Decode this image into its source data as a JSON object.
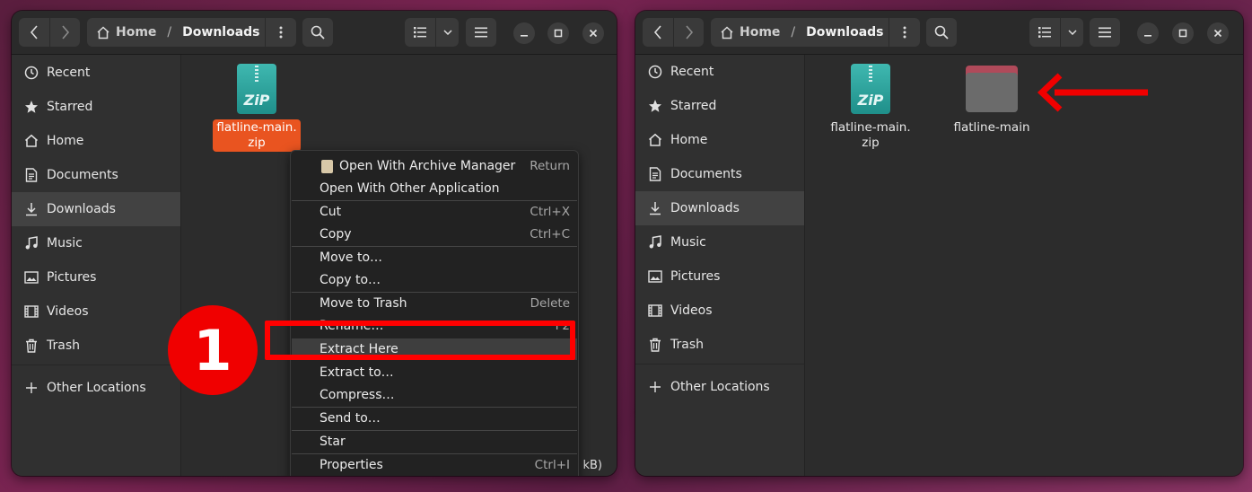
{
  "left_window": {
    "path": {
      "home": "Home",
      "current": "Downloads"
    },
    "sidebar": [
      {
        "label": "Recent",
        "icon": "clock-icon"
      },
      {
        "label": "Starred",
        "icon": "star-icon"
      },
      {
        "label": "Home",
        "icon": "home-icon"
      },
      {
        "label": "Documents",
        "icon": "document-icon"
      },
      {
        "label": "Downloads",
        "icon": "download-icon",
        "selected": true
      },
      {
        "label": "Music",
        "icon": "music-icon"
      },
      {
        "label": "Pictures",
        "icon": "picture-icon"
      },
      {
        "label": "Videos",
        "icon": "video-icon"
      },
      {
        "label": "Trash",
        "icon": "trash-icon"
      },
      {
        "label": "Other Locations",
        "icon": "plus-icon"
      }
    ],
    "files": [
      {
        "name_line1": "flatline-main.",
        "name_line2": "zip",
        "type": "zip",
        "selected": true
      }
    ],
    "status_fragment": "3 kB)",
    "context_menu": [
      {
        "label": "Open With Archive Manager",
        "accel": "Return",
        "icon": "archive-manager-icon"
      },
      {
        "label": "Open With Other Application",
        "accel": ""
      },
      {
        "label": "Cut",
        "accel": "Ctrl+X"
      },
      {
        "label": "Copy",
        "accel": "Ctrl+C"
      },
      {
        "label": "Move to…",
        "accel": ""
      },
      {
        "label": "Copy to…",
        "accel": ""
      },
      {
        "label": "Move to Trash",
        "accel": "Delete"
      },
      {
        "label": "Rename…",
        "accel": "F2"
      },
      {
        "label": "Extract Here",
        "accel": "",
        "hover": true
      },
      {
        "label": "Extract to…",
        "accel": ""
      },
      {
        "label": "Compress…",
        "accel": ""
      },
      {
        "label": "Send to…",
        "accel": ""
      },
      {
        "label": "Star",
        "accel": ""
      },
      {
        "label": "Properties",
        "accel": "Ctrl+I"
      }
    ]
  },
  "right_window": {
    "path": {
      "home": "Home",
      "current": "Downloads"
    },
    "sidebar": [
      {
        "label": "Recent",
        "icon": "clock-icon"
      },
      {
        "label": "Starred",
        "icon": "star-icon"
      },
      {
        "label": "Home",
        "icon": "home-icon"
      },
      {
        "label": "Documents",
        "icon": "document-icon"
      },
      {
        "label": "Downloads",
        "icon": "download-icon",
        "selected": true
      },
      {
        "label": "Music",
        "icon": "music-icon"
      },
      {
        "label": "Pictures",
        "icon": "picture-icon"
      },
      {
        "label": "Videos",
        "icon": "video-icon"
      },
      {
        "label": "Trash",
        "icon": "trash-icon"
      },
      {
        "label": "Other Locations",
        "icon": "plus-icon"
      }
    ],
    "files": [
      {
        "name_line1": "flatline-main.",
        "name_line2": "zip",
        "type": "zip"
      },
      {
        "name_line1": "flatline-main",
        "name_line2": "",
        "type": "folder"
      }
    ]
  },
  "annotation": {
    "step_number": "1",
    "highlight_color": "#ff0000"
  },
  "colors": {
    "accent": "#e95420",
    "window_bg": "#2c2c2c",
    "sidebar_bg": "#303030",
    "selected_bg": "#424242"
  }
}
